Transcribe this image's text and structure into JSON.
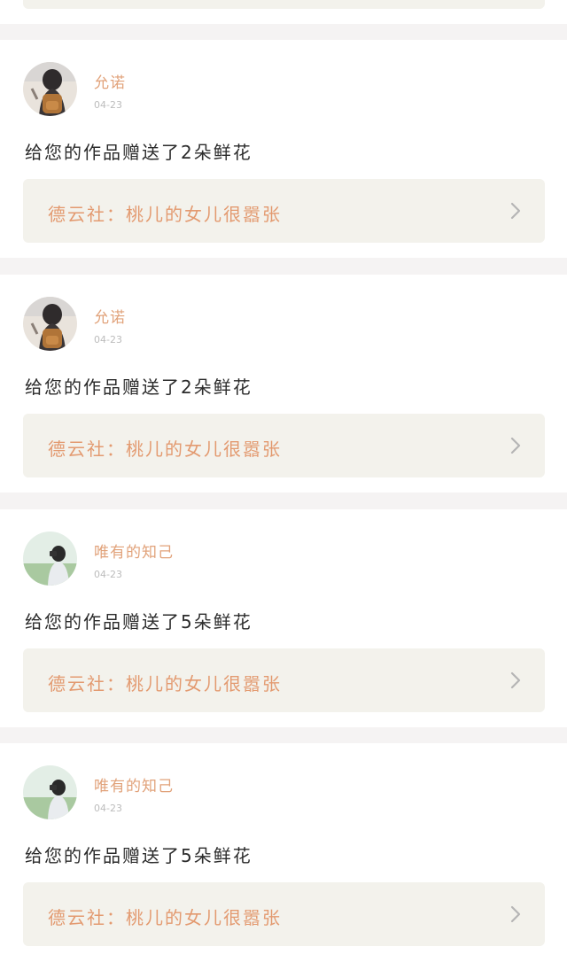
{
  "feed": {
    "items": [
      {
        "username": "允诺",
        "date": "04-23",
        "message": "给您的作品赠送了2朵鲜花",
        "work_title": "德云社：桃儿的女儿很嚣张",
        "avatar": "girl-with-backpack-avatar"
      },
      {
        "username": "允诺",
        "date": "04-23",
        "message": "给您的作品赠送了2朵鲜花",
        "work_title": "德云社：桃儿的女儿很嚣张",
        "avatar": "girl-with-backpack-avatar"
      },
      {
        "username": "唯有的知己",
        "date": "04-23",
        "message": "给您的作品赠送了5朵鲜花",
        "work_title": "德云社：桃儿的女儿很嚣张",
        "avatar": "girl-with-camera-avatar"
      },
      {
        "username": "唯有的知己",
        "date": "04-23",
        "message": "给您的作品赠送了5朵鲜花",
        "work_title": "德云社：桃儿的女儿很嚣张",
        "avatar": "girl-with-camera-avatar"
      }
    ]
  },
  "icons": {
    "chevron": "chevron-right-icon"
  },
  "colors": {
    "page_background": "#f5f3f3",
    "card_background": "#ffffff",
    "username": "#e1a27a",
    "date": "#bcbcbc",
    "message": "#2b2b2b",
    "link_background": "#f3f2ec",
    "link_text": "#e39a70",
    "chevron": "#b5b5b5"
  }
}
